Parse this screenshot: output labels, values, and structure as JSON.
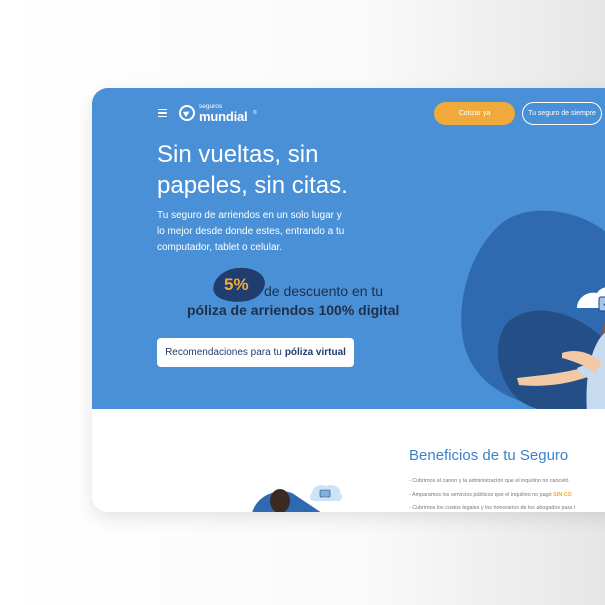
{
  "header": {
    "logo_small": "seguros",
    "logo_big": "mundial",
    "logo_reg": "®",
    "cta_primary": "Cotizar ya",
    "cta_secondary": "Tu seguro de siempre"
  },
  "hero": {
    "headline_line1": "Sin vueltas, sin",
    "headline_line2": "papeles, sin citas.",
    "subtext_line1": "Tu seguro de arriendos en un solo lugar y",
    "subtext_line2": "lo mejor desde donde estes, entrando a tu",
    "subtext_line3": "computador, tablet o celular.",
    "discount_pct": "5%",
    "discount_line1": "de descuento en tu",
    "discount_line2": "póliza de arriendos 100% digital",
    "rec_label": "Recomendaciones para tu",
    "rec_bold": "póliza virtual"
  },
  "benefits": {
    "title": "Beneficios de tu Seguro",
    "items": [
      "- Cubrimos el canon y la administración que el inquilino no canceló.",
      "- Amparamos los servicios públicos que el inquilino no pagó",
      "- Cubrimos los costos legales y los honorarios de los abogados para l"
    ],
    "item2_highlight": "SIN CO"
  },
  "icons": {
    "menu": "hamburger-menu-icon",
    "logo": "seguros-mundial-logo",
    "monitor": "monitor-check-icon"
  },
  "colors": {
    "hero_bg": "#4a90d6",
    "accent": "#f0a93b",
    "dark_blue": "#1f3d6e",
    "title_blue": "#3b82c8"
  }
}
